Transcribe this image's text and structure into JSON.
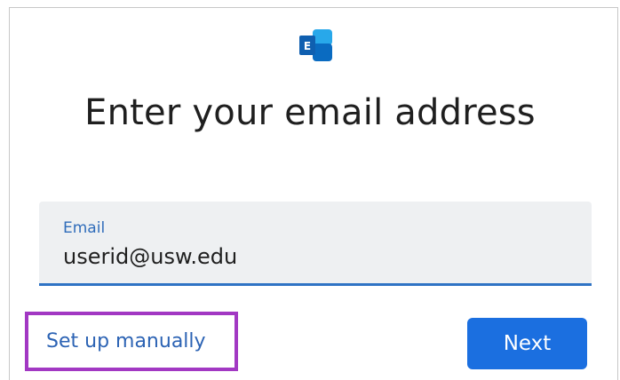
{
  "header": {
    "logo_icon": "exchange-logo-icon",
    "logo_letter": "E",
    "title": "Enter your email address"
  },
  "form": {
    "email_label": "Email",
    "email_value": "userid@usw.edu"
  },
  "actions": {
    "manual_label": "Set up manually",
    "next_label": "Next"
  },
  "colors": {
    "accent_blue": "#1b6fe0",
    "link_blue": "#2c63b4",
    "highlight_purple": "#a238c3",
    "field_background": "#eef0f2"
  }
}
